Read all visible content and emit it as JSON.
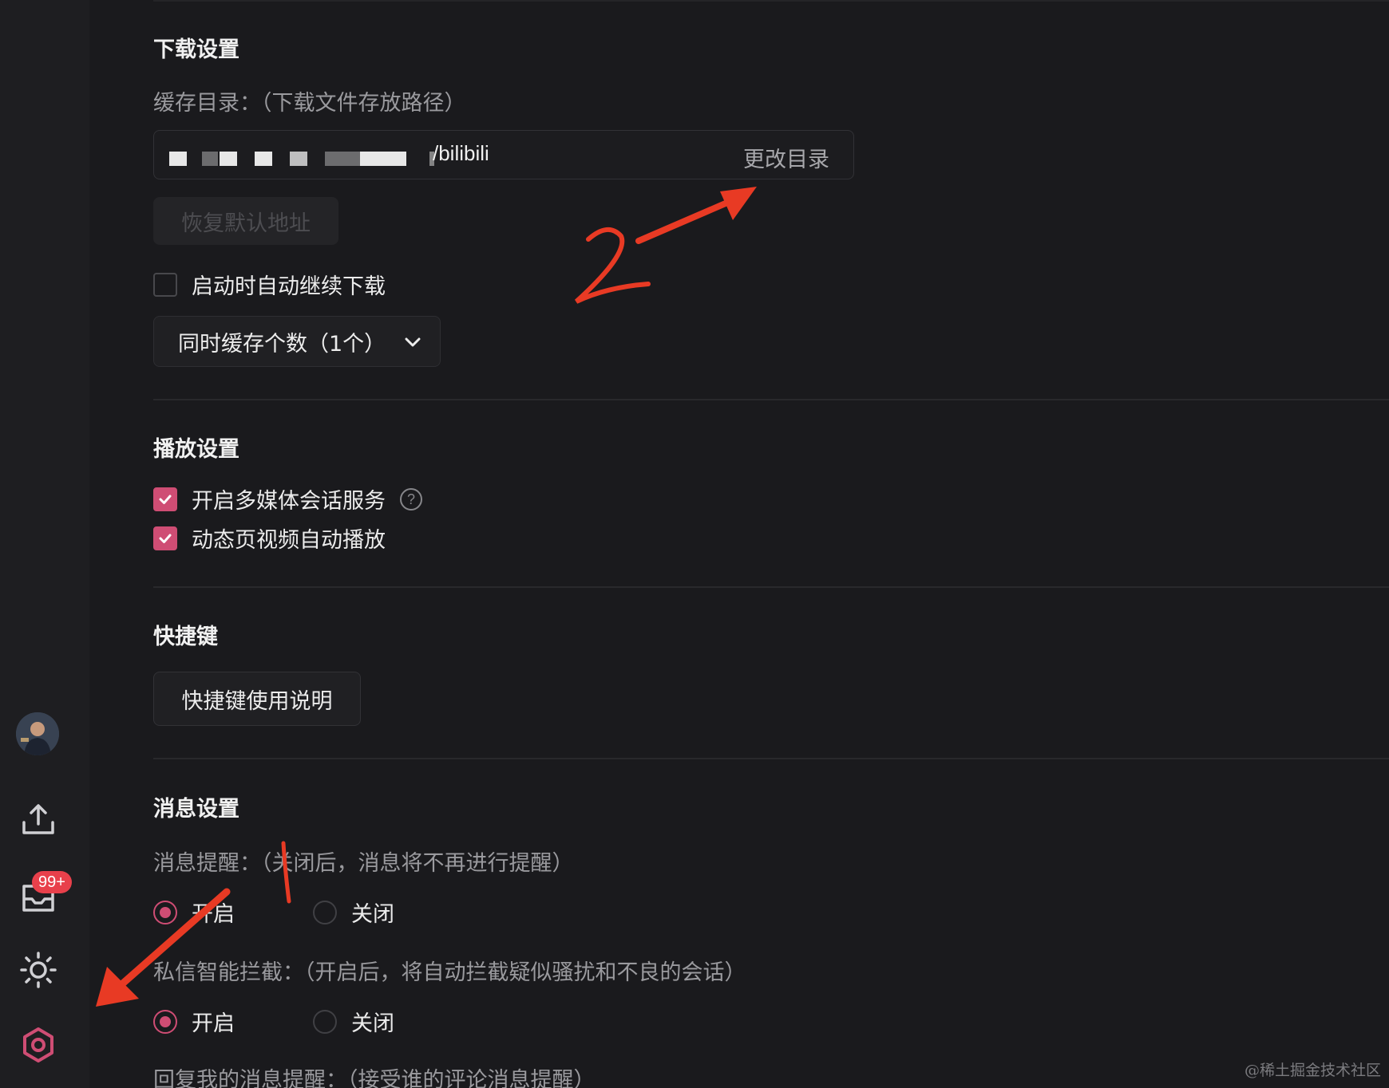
{
  "sidebar": {
    "icons": [
      "avatar",
      "upload-icon",
      "message-icon",
      "theme-sun-icon",
      "settings-icon"
    ],
    "badge": "99+",
    "accent_color": "#cf4d74"
  },
  "download": {
    "title": "下载设置",
    "cache_label": "缓存目录：（下载文件存放路径）",
    "path_suffix": "/bilibili",
    "change_dir": "更改目录",
    "restore_default": "恢复默认地址",
    "auto_resume": "启动时自动继续下载",
    "concurrent": "同时缓存个数（1个）"
  },
  "playback": {
    "title": "播放设置",
    "media_session": "开启多媒体会话服务",
    "help": "?",
    "autoplay": "动态页视频自动播放"
  },
  "shortcut": {
    "title": "快捷键",
    "button": "快捷键使用说明"
  },
  "message": {
    "title": "消息设置",
    "reminder_label": "消息提醒：（关闭后，消息将不再进行提醒）",
    "on": "开启",
    "off": "关闭",
    "intercept_label": "私信智能拦截：（开启后，将自动拦截疑似骚扰和不良的会话）",
    "reply_label": "回复我的消息提醒：（接受谁的评论消息提醒）"
  },
  "annotations": {
    "number_2": "2",
    "number_1": "1"
  },
  "watermark": "@稀土掘金技术社区"
}
